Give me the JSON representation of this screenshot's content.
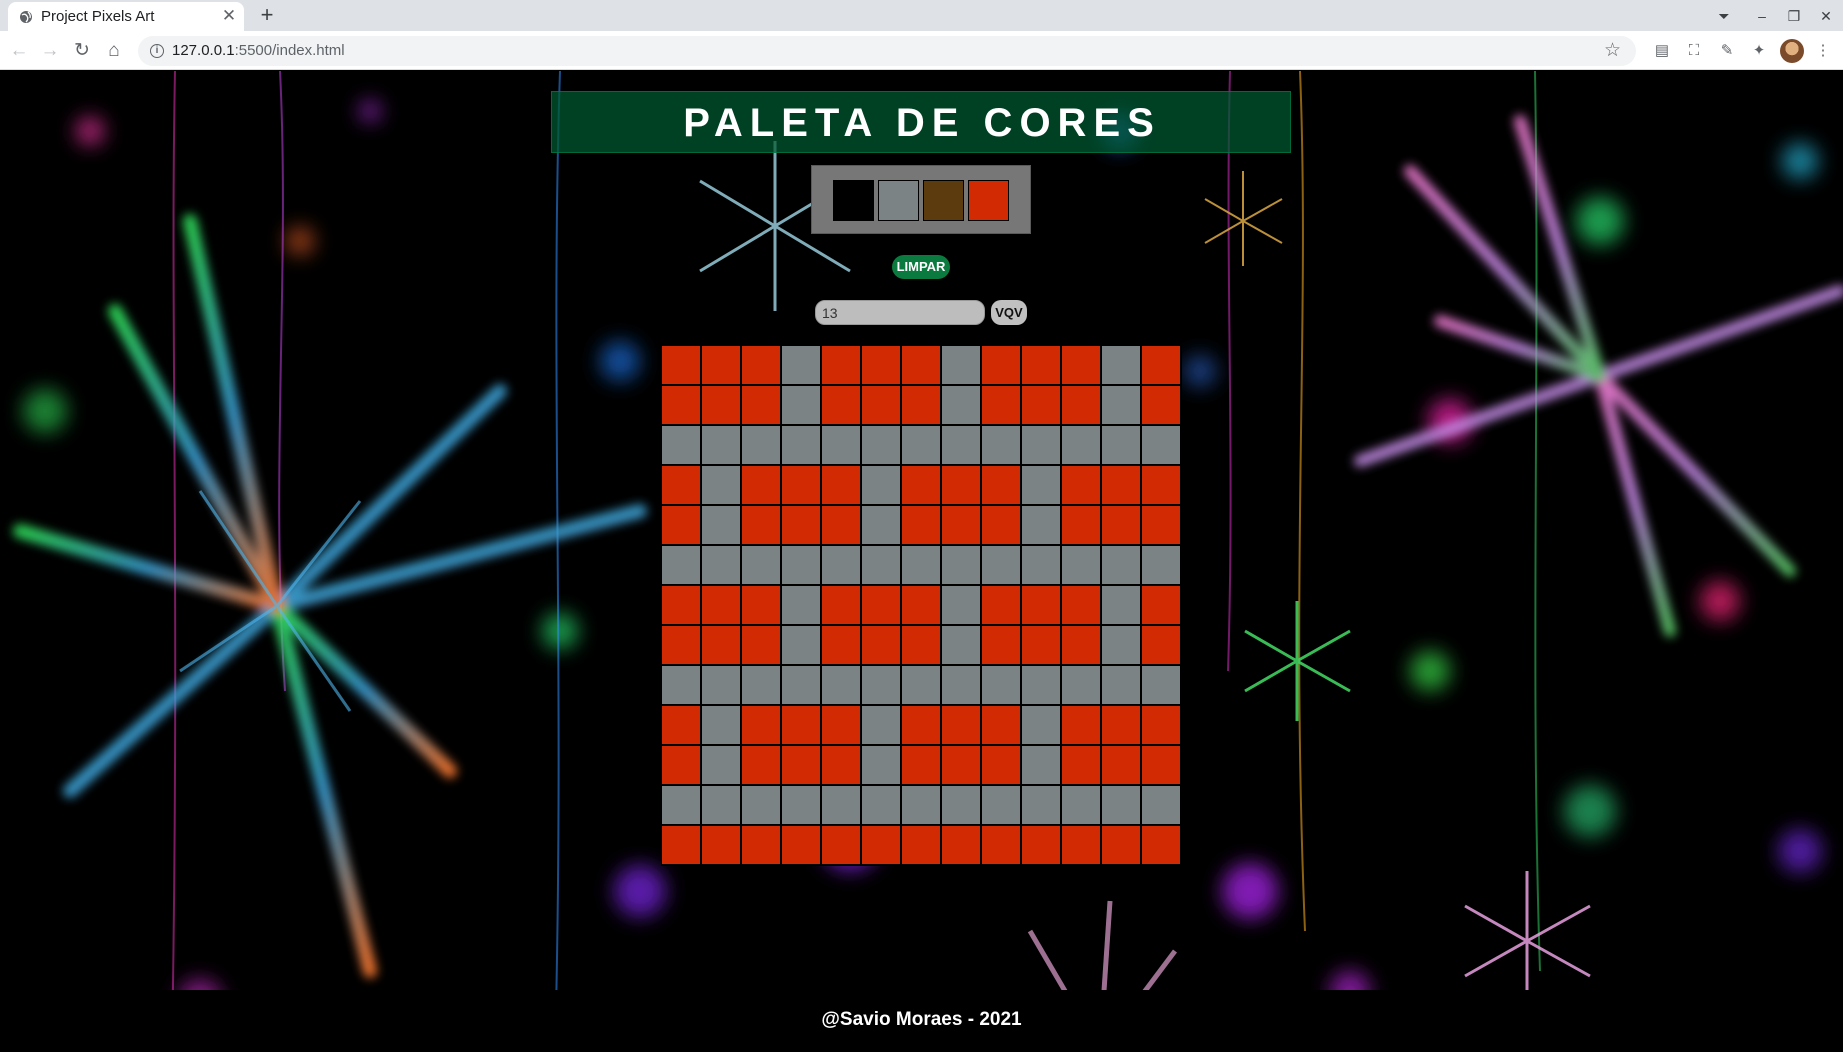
{
  "browser": {
    "tab_title": "Project Pixels Art",
    "url_host": "127.0.0.1",
    "url_rest": ":5500/index.html"
  },
  "page": {
    "title": "PALETA DE CORES",
    "palette": [
      {
        "color": "#000000",
        "name": "black"
      },
      {
        "color": "#7c8385",
        "name": "gray"
      },
      {
        "color": "#5c3c0e",
        "name": "brown"
      },
      {
        "color": "#d22a03",
        "name": "red-orange"
      }
    ],
    "clear_button": "LIMPAR",
    "board_size_input": "13",
    "generate_button": "VQV",
    "board": {
      "size": 13,
      "colors": {
        "R": "#d22a03",
        "G": "#7c8385"
      },
      "rows": [
        "RRRGRRRGRRRGR",
        "RRRGRRRGRRRGR",
        "GGGGGGGGGGGGG",
        "RGRRRGRRRGRRR",
        "RGRRRGRRRGRRR",
        "GGGGGGGGGGGGG",
        "RRRGRRRGRRRGR",
        "RRRGRRRGRRRGR",
        "GGGGGGGGGGGGG",
        "RGRRRGRRRGRRR",
        "RGRRRGRRRGRRR",
        "GGGGGGGGGGGGG",
        "RRRRRRRRRRRRR"
      ]
    },
    "footer": "@Savio Moraes - 2021"
  }
}
